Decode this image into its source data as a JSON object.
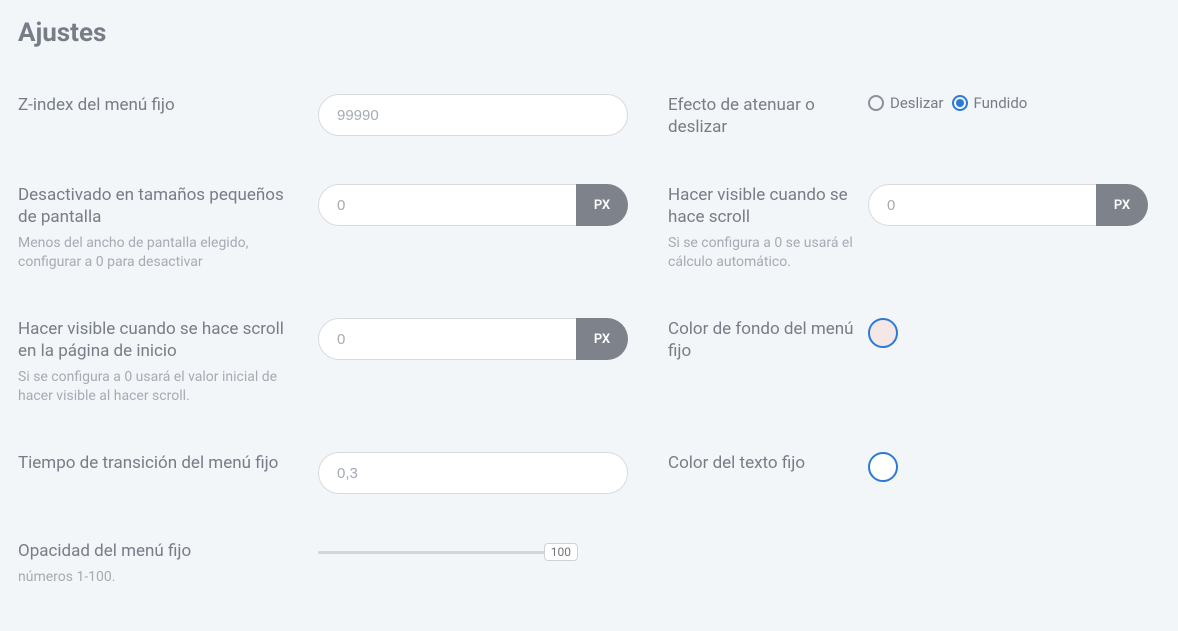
{
  "title": "Ajustes",
  "zindex": {
    "label": "Z-index del menú fijo",
    "value": "99990"
  },
  "effect": {
    "label": "Efecto de atenuar o deslizar",
    "option1": "Deslizar",
    "option2": "Fundido"
  },
  "disableSmall": {
    "label": "Desactivado en tamaños pequeños de pantalla",
    "helper": "Menos del ancho de pantalla elegido, configurar a 0 para desactivar",
    "value": "0",
    "suffix": "PX"
  },
  "visibleScroll": {
    "label": "Hacer visible cuando se hace scroll",
    "helper": "Si se configura a 0 se usará el cálculo automático.",
    "value": "0",
    "suffix": "PX"
  },
  "visibleScrollHome": {
    "label": "Hacer visible cuando se hace scroll en la página de inicio",
    "helper": "Si se configura a 0 usará el valor inicial de hacer visible al hacer scroll.",
    "value": "0",
    "suffix": "PX"
  },
  "bgColor": {
    "label": "Color de fondo del menú fijo"
  },
  "transition": {
    "label": "Tiempo de transición del menú fijo",
    "value": "0,3"
  },
  "textColor": {
    "label": "Color del texto fijo"
  },
  "opacity": {
    "label": "Opacidad del menú fijo",
    "helper": "números 1-100.",
    "value": "100"
  }
}
